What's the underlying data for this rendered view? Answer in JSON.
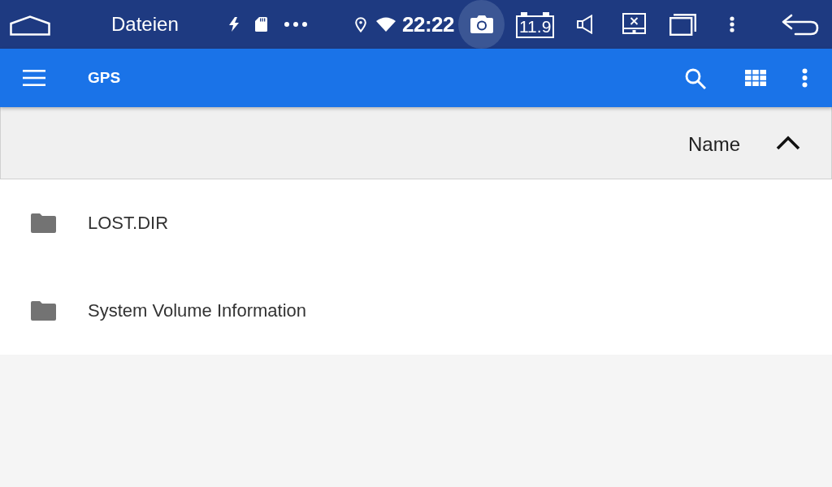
{
  "status_bar": {
    "app_title": "Dateien",
    "time": "22:22",
    "camera_pressed": true,
    "battery_reading": "11.9"
  },
  "toolbar": {
    "title": "GPS"
  },
  "list_header": {
    "sort_label": "Name",
    "sort_ascending": true
  },
  "files": [
    {
      "name": "LOST.DIR"
    },
    {
      "name": "System Volume Information"
    }
  ]
}
